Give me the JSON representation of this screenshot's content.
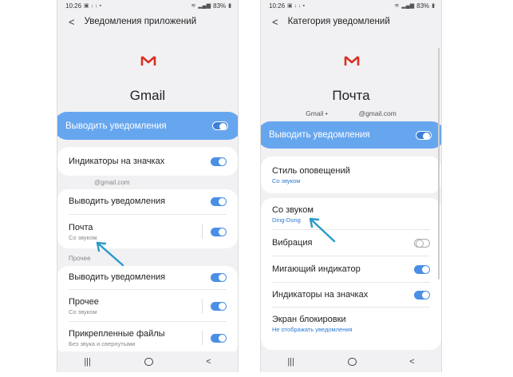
{
  "left_phone": {
    "status": {
      "time": "10:26",
      "battery": "83%"
    },
    "header": {
      "title": "Уведомления приложений"
    },
    "app": {
      "name": "Gmail"
    },
    "rows": {
      "show_notifications": "Выводить уведомления",
      "badge_indicators": "Индикаторы на значках",
      "account_label": "@gmail.com",
      "account_show": "Выводить уведомления",
      "mail_label": "Почта",
      "mail_sub": "Со звуком",
      "section_other": "Прочее",
      "other_show": "Выводить уведомления",
      "other_label": "Прочее",
      "other_sub": "Со звуком",
      "attachments_label": "Прикрепленные файлы",
      "attachments_sub": "Без звука и свернутыми"
    }
  },
  "right_phone": {
    "status": {
      "time": "10:26",
      "battery": "83%"
    },
    "header": {
      "title": "Категория уведомлений"
    },
    "category": {
      "name": "Почта",
      "account_prefix": "Gmail •",
      "account_suffix": "@gmail.com"
    },
    "rows": {
      "show_notifications": "Выводить уведомления",
      "alert_style_label": "Стиль оповещений",
      "alert_style_sub": "Со звуком",
      "sound_label": "Со звуком",
      "sound_sub": "Ding-Dong",
      "vibration": "Вибрация",
      "blinking_led": "Мигающий индикатор",
      "badge_indicators": "Индикаторы на значках",
      "lock_screen_label": "Экран блокировки",
      "lock_screen_sub": "Не отображать уведомления"
    }
  },
  "colors": {
    "accent": "#66a6ef",
    "toggle_on": "#4a8fe6",
    "arrow": "#2a9bc9",
    "gmail_red": "#d93025"
  },
  "icons": [
    "back-arrow-icon",
    "gmail-logo-icon",
    "recent-apps-icon",
    "home-icon",
    "back-nav-icon",
    "wifi-icon",
    "signal-icon",
    "battery-icon"
  ]
}
